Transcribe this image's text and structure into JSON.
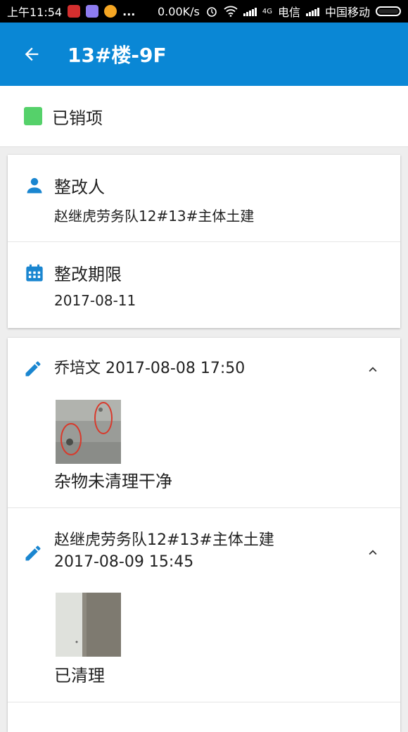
{
  "status_bar": {
    "time": "上午11:54",
    "dots": "...",
    "speed": "0.00K/s",
    "net_4g": "4G",
    "carrier1": "电信",
    "carrier2": "中国移动"
  },
  "app_bar": {
    "title": "13#楼-9F",
    "back_icon": "arrow-left-icon"
  },
  "status": {
    "label": "已销项",
    "color": "#55d16a"
  },
  "info": {
    "assignee_label": "整改人",
    "assignee_value": "赵继虎劳务队12#13#主体土建",
    "deadline_label": "整改期限",
    "deadline_value": "2017-08-11"
  },
  "logs": [
    {
      "author": "乔培文 2017-08-08 17:50",
      "note": "杂物未清理干净"
    },
    {
      "author": "赵继虎劳务队12#13#主体土建",
      "time": "2017-08-09 15:45",
      "note": "已清理"
    }
  ],
  "colors": {
    "primary": "#0a87d5",
    "icon_blue": "#1a86d0"
  }
}
